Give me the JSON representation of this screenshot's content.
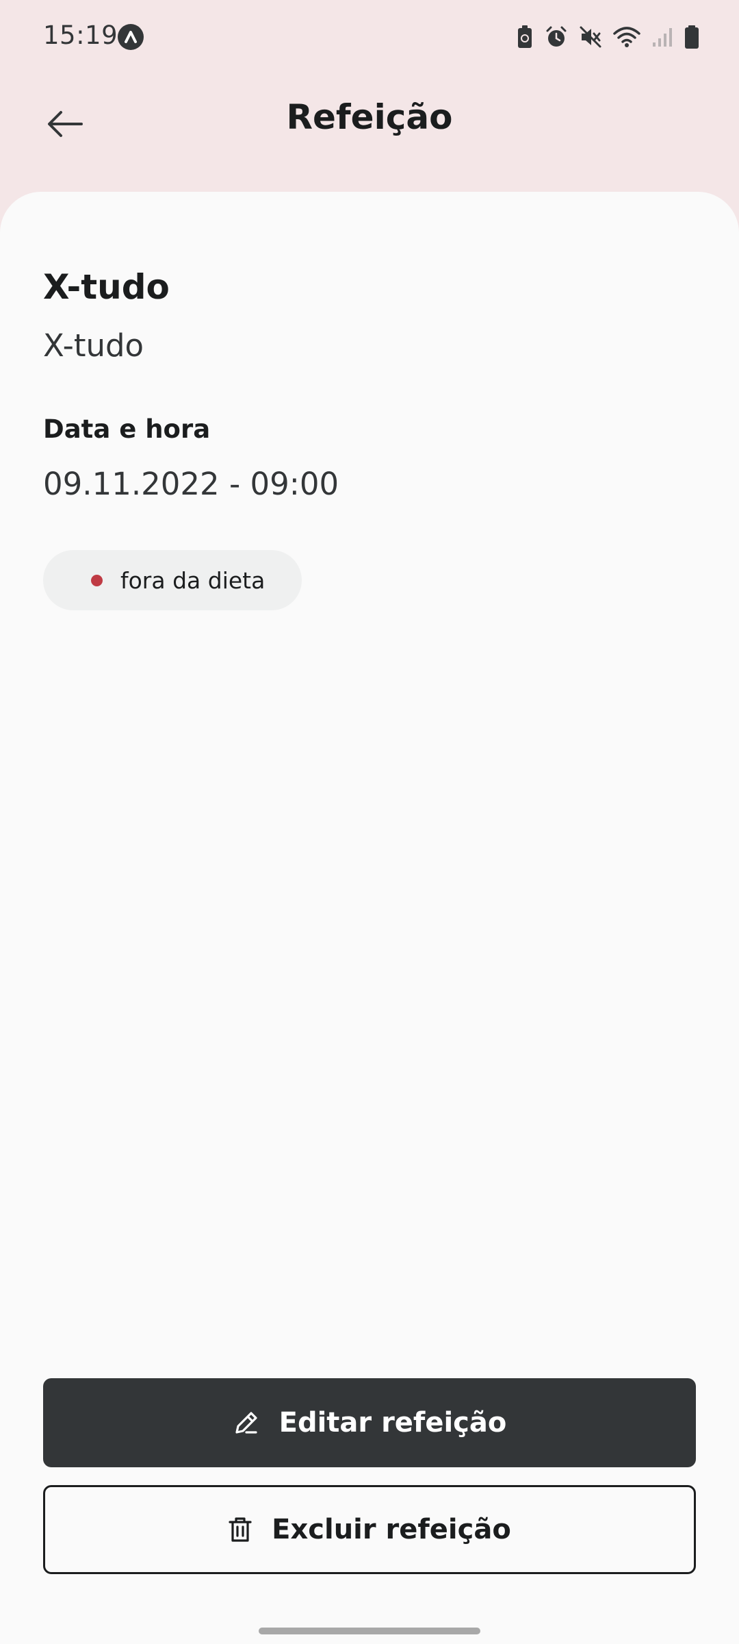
{
  "status_bar": {
    "time": "15:19"
  },
  "header": {
    "title": "Refeição"
  },
  "meal": {
    "name": "X-tudo",
    "description": "X-tudo",
    "datetime_label": "Data e hora",
    "datetime_value": "09.11.2022 - 09:00",
    "status_label": "fora da dieta",
    "status_color": "#BF3B44"
  },
  "actions": {
    "edit_label": "Editar refeição",
    "delete_label": "Excluir refeição"
  },
  "icons": {
    "back": "arrow-left-icon",
    "edit": "pencil-icon",
    "delete": "trash-icon"
  },
  "colors": {
    "header_bg": "#F4E6E7",
    "content_bg": "#FAFAFA",
    "primary_dark": "#333638",
    "badge_bg": "#EFF0F0"
  }
}
